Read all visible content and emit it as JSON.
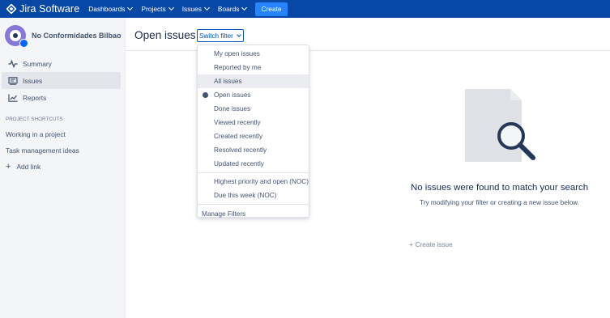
{
  "topnav": {
    "logo_text": "Jira Software",
    "items": [
      {
        "label": "Dashboards"
      },
      {
        "label": "Projects"
      },
      {
        "label": "Issues"
      },
      {
        "label": "Boards"
      }
    ],
    "create_label": "Create",
    "colors": {
      "bar": "#0747a6",
      "create": "#2684ff"
    }
  },
  "sidebar": {
    "project_name": "No Conformidades Bilbao",
    "items": [
      {
        "label": "Summary",
        "icon": "pulse-icon"
      },
      {
        "label": "Issues",
        "icon": "issues-icon",
        "active": true
      },
      {
        "label": "Reports",
        "icon": "chart-icon"
      }
    ],
    "shortcuts_title": "PROJECT SHORTCUTS",
    "shortcuts": [
      {
        "label": "Working in a project"
      },
      {
        "label": "Task management ideas"
      }
    ],
    "add_link_label": "Add link"
  },
  "main": {
    "title": "Open issues",
    "switch_filter_label": "Switch filter"
  },
  "filter_menu": {
    "group1": [
      {
        "label": "My open issues"
      },
      {
        "label": "Reported by me"
      },
      {
        "label": "All issues",
        "highlighted": true
      },
      {
        "label": "Open issues",
        "selected": true
      },
      {
        "label": "Done issues"
      },
      {
        "label": "Viewed recently"
      },
      {
        "label": "Created recently"
      },
      {
        "label": "Resolved recently"
      },
      {
        "label": "Updated recently"
      }
    ],
    "group2": [
      {
        "label": "Highest priority and open (NOC)"
      },
      {
        "label": "Due this week (NOC)"
      }
    ],
    "manage_label": "Manage Filters"
  },
  "empty_state": {
    "title": "No issues were found to match your search",
    "subtitle": "Try modifying your filter or creating a new issue below.",
    "create_issue_label": "Create issue"
  }
}
